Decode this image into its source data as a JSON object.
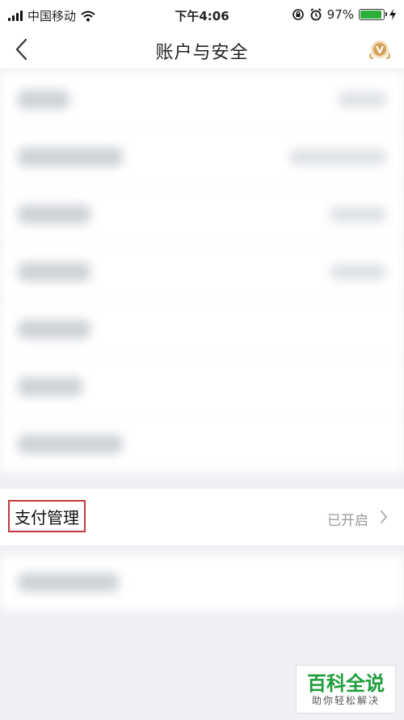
{
  "status_bar": {
    "carrier": "中国移动",
    "time": "下午4:06",
    "battery_percent": "97%",
    "battery_level": 0.97,
    "battery_color": "#2ab03a"
  },
  "nav": {
    "title": "账户与安全",
    "back_icon": "chevron-left-icon",
    "right_icon": "vip-badge-icon",
    "accent": "#d3a15a"
  },
  "settings": {
    "pay_management": {
      "label": "支付管理",
      "value": "已开启",
      "highlight_color": "#c0393b"
    }
  },
  "watermark": {
    "title": "百科全说",
    "subtitle": "助你轻松解决",
    "color": "#1e9e3a"
  }
}
